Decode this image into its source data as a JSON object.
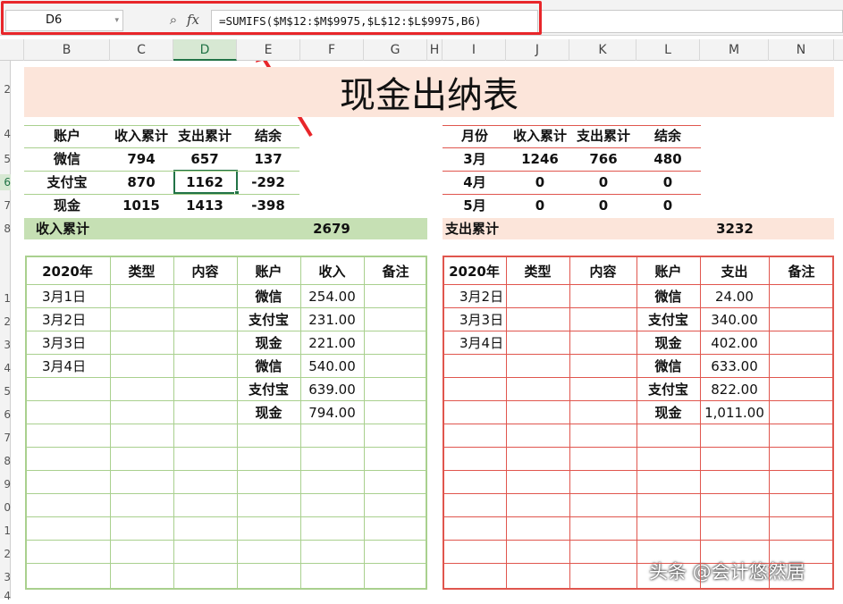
{
  "formula_bar": {
    "name_box": "D6",
    "fx_label": "fx",
    "formula": "=SUMIFS($M$12:$M$9975,$L$12:$L$9975,B6)"
  },
  "column_headers": [
    "B",
    "C",
    "D",
    "E",
    "F",
    "G",
    "H",
    "I",
    "J",
    "K",
    "L",
    "M",
    "N"
  ],
  "row_headers": [
    "2",
    "4",
    "5",
    "6",
    "7",
    "8",
    "",
    "1",
    "2",
    "3",
    "4",
    "5",
    "6",
    "7",
    "8",
    "9",
    "0",
    "1",
    "2",
    "3",
    "4"
  ],
  "title": "现金出纳表",
  "accounts_table": {
    "headers": [
      "账户",
      "收入累计",
      "支出累计",
      "结余"
    ],
    "rows": [
      [
        "微信",
        "794",
        "657",
        "137"
      ],
      [
        "支付宝",
        "870",
        "1162",
        "-292"
      ],
      [
        "现金",
        "1015",
        "1413",
        "-398"
      ]
    ],
    "total_label": "收入累计",
    "total_value": "2679"
  },
  "monthly_table": {
    "headers": [
      "月份",
      "收入累计",
      "支出累计",
      "结余"
    ],
    "rows": [
      [
        "3月",
        "1246",
        "766",
        "480"
      ],
      [
        "4月",
        "0",
        "0",
        "0"
      ],
      [
        "5月",
        "0",
        "0",
        "0"
      ]
    ],
    "total_label": "支出累计",
    "total_value": "3232"
  },
  "income_ledger": {
    "headers": [
      "2020年",
      "类型",
      "内容",
      "账户",
      "收入",
      "备注"
    ],
    "rows": [
      [
        "3月1日",
        "",
        "",
        "微信",
        "254.00",
        ""
      ],
      [
        "3月2日",
        "",
        "",
        "支付宝",
        "231.00",
        ""
      ],
      [
        "3月3日",
        "",
        "",
        "现金",
        "221.00",
        ""
      ],
      [
        "3月4日",
        "",
        "",
        "微信",
        "540.00",
        ""
      ],
      [
        "",
        "",
        "",
        "支付宝",
        "639.00",
        ""
      ],
      [
        "",
        "",
        "",
        "现金",
        "794.00",
        ""
      ]
    ]
  },
  "expense_ledger": {
    "headers": [
      "2020年",
      "类型",
      "内容",
      "账户",
      "支出",
      "备注"
    ],
    "rows": [
      [
        "3月2日",
        "",
        "",
        "微信",
        "24.00",
        ""
      ],
      [
        "3月3日",
        "",
        "",
        "支付宝",
        "340.00",
        ""
      ],
      [
        "3月4日",
        "",
        "",
        "现金",
        "402.00",
        ""
      ],
      [
        "",
        "",
        "",
        "微信",
        "633.00",
        ""
      ],
      [
        "",
        "",
        "",
        "支付宝",
        "822.00",
        ""
      ],
      [
        "",
        "",
        "",
        "现金",
        "1,011.00",
        ""
      ]
    ]
  },
  "watermark": "头条 @会计悠然居",
  "colors": {
    "accent_red": "#e8262a",
    "green_line": "#a9d08e",
    "red_line": "#e0564e",
    "peach_fill": "#fce5da",
    "green_fill": "#c6e0b4"
  }
}
